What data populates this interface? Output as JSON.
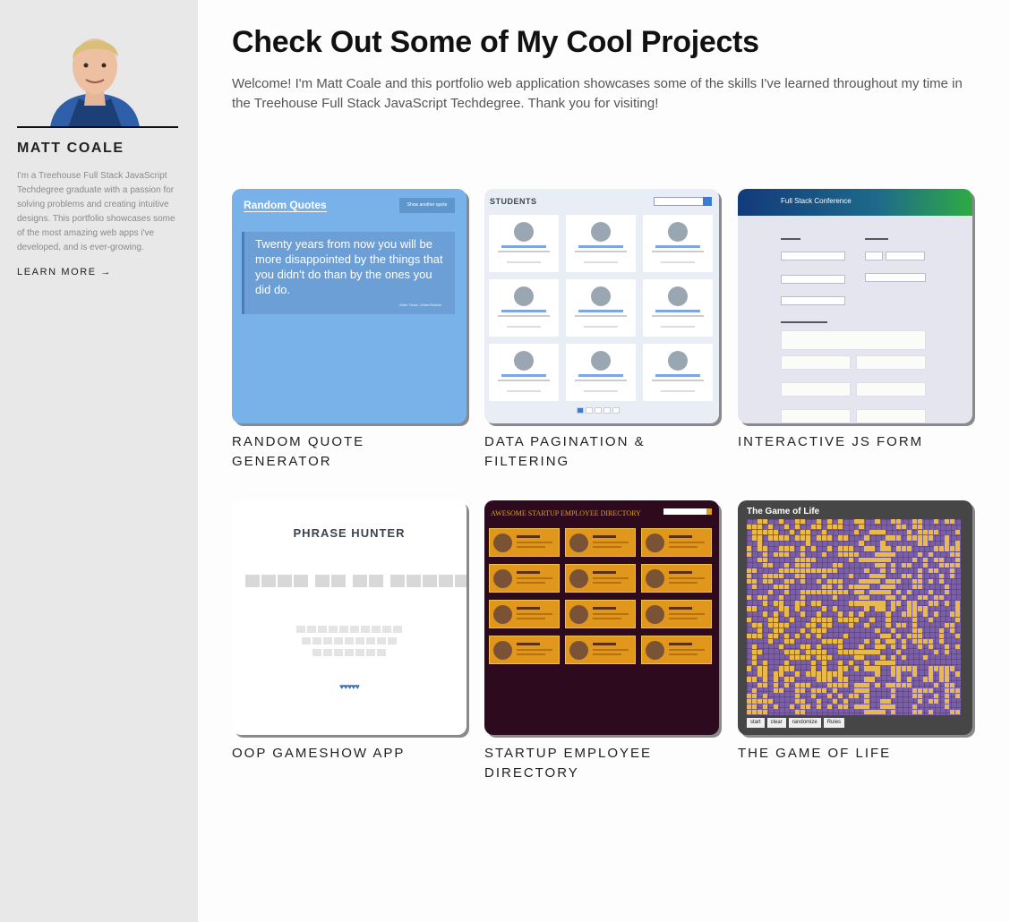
{
  "sidebar": {
    "name": "MATT COALE",
    "bio": "I'm a Treehouse Full Stack JavaScript Techdegree graduate with a passion for solving problems and creating intuitive designs. This portfolio showcases some of the most amazing web apps i've developed, and is ever-growing.",
    "learn_more": "LEARN MORE →"
  },
  "main": {
    "title": "Check Out Some of My Cool Projects",
    "welcome": "Welcome! I'm Matt Coale and this portfolio web application showcases some of the skills I've learned throughout my time in the Treehouse Full Stack JavaScript Techdegree. Thank you for visiting!"
  },
  "projects": [
    {
      "title": "RANDOM QUOTE GENERATOR"
    },
    {
      "title": "DATA PAGINATION & FILTERING"
    },
    {
      "title": "INTERACTIVE JS FORM"
    },
    {
      "title": "OOP GAMESHOW APP"
    },
    {
      "title": "STARTUP EMPLOYEE DIRECTORY"
    },
    {
      "title": "THE GAME OF LIFE"
    }
  ],
  "thumb_text": {
    "quote_heading": "Random Quotes",
    "quote_button": "Show another quote",
    "quote_text": "Twenty years from now you will be more disappointed by the things that you didn't do than by the ones you did do.",
    "quote_author": "- Mark Twain, Writer/Satirist",
    "pagination_heading": "STUDENTS",
    "form_heading": "Full Stack Conference",
    "phrase_heading": "PHRASE HUNTER",
    "directory_heading": "AWESOME STARTUP EMPLOYEE DIRECTORY",
    "life_heading": "The Game of Life",
    "life_buttons": [
      "start",
      "clear",
      "randomize",
      "Rules"
    ]
  },
  "colors": {
    "sidebar_bg": "#e8e8e8",
    "quote_bg": "#79b1e9",
    "directory_bg": "#2e0a1e",
    "life_purple": "#7b5ea8",
    "life_yellow": "#e9b94b"
  }
}
